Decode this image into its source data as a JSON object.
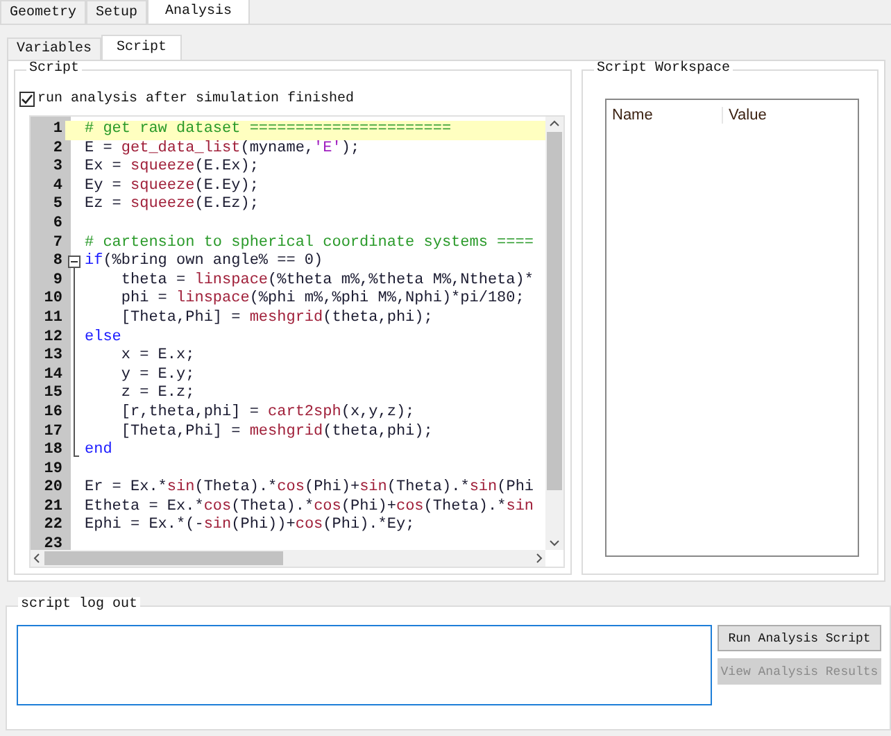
{
  "tabs": [
    {
      "label": "Geometry",
      "selected": false
    },
    {
      "label": "Setup",
      "selected": false
    },
    {
      "label": "Analysis",
      "selected": true
    }
  ],
  "subtabs": [
    {
      "label": "Variables",
      "selected": false
    },
    {
      "label": "Script",
      "selected": true
    }
  ],
  "script_group": {
    "title": "Script",
    "checkbox": {
      "label": "run analysis after simulation finished",
      "checked": true
    },
    "editor": {
      "lines": [
        {
          "n": "1",
          "current": true,
          "kind": "plain",
          "segments": [
            {
              "t": "# get raw dataset ======================",
              "kind": "comment"
            }
          ]
        },
        {
          "n": "2",
          "current": false,
          "kind": "plain",
          "segments": [
            {
              "t": "E = ",
              "kind": "plain"
            },
            {
              "t": "get_data_list",
              "kind": "func"
            },
            {
              "t": "(myname,",
              "kind": "plain"
            },
            {
              "t": "'E'",
              "kind": "string"
            },
            {
              "t": ");",
              "kind": "plain"
            }
          ]
        },
        {
          "n": "3",
          "current": false,
          "kind": "plain",
          "segments": [
            {
              "t": "Ex = ",
              "kind": "plain"
            },
            {
              "t": "squeeze",
              "kind": "func"
            },
            {
              "t": "(E.Ex);",
              "kind": "plain"
            }
          ]
        },
        {
          "n": "4",
          "current": false,
          "kind": "plain",
          "segments": [
            {
              "t": "Ey = ",
              "kind": "plain"
            },
            {
              "t": "squeeze",
              "kind": "func"
            },
            {
              "t": "(E.Ey);",
              "kind": "plain"
            }
          ]
        },
        {
          "n": "5",
          "current": false,
          "kind": "plain",
          "segments": [
            {
              "t": "Ez = ",
              "kind": "plain"
            },
            {
              "t": "squeeze",
              "kind": "func"
            },
            {
              "t": "(E.Ez);",
              "kind": "plain"
            }
          ]
        },
        {
          "n": "6",
          "current": false,
          "kind": "plain"
        },
        {
          "n": "7",
          "current": false,
          "kind": "plain",
          "segments": [
            {
              "t": "# cartension to spherical coordinate systems ====",
              "kind": "comment"
            }
          ]
        },
        {
          "n": "8",
          "current": false,
          "kind": "fold-start",
          "segments": [
            {
              "t": "if",
              "kind": "keyword"
            },
            {
              "t": "(%bring own angle% == 0)",
              "kind": "plain"
            }
          ]
        },
        {
          "n": "9",
          "current": false,
          "kind": "fold-inside",
          "segments": [
            {
              "t": "    theta = ",
              "kind": "plain"
            },
            {
              "t": "linspace",
              "kind": "func"
            },
            {
              "t": "(%theta m%,%theta M%,Ntheta)*",
              "kind": "plain"
            }
          ]
        },
        {
          "n": "10",
          "current": false,
          "kind": "fold-inside",
          "segments": [
            {
              "t": "    phi = ",
              "kind": "plain"
            },
            {
              "t": "linspace",
              "kind": "func"
            },
            {
              "t": "(%phi m%,%phi M%,Nphi)*pi/180;",
              "kind": "plain"
            }
          ]
        },
        {
          "n": "11",
          "current": false,
          "kind": "fold-inside",
          "segments": [
            {
              "t": "    [Theta,Phi] = ",
              "kind": "plain"
            },
            {
              "t": "meshgrid",
              "kind": "func"
            },
            {
              "t": "(theta,phi);",
              "kind": "plain"
            }
          ]
        },
        {
          "n": "12",
          "current": false,
          "kind": "fold-inside",
          "segments": [
            {
              "t": "else",
              "kind": "keyword"
            }
          ]
        },
        {
          "n": "13",
          "current": false,
          "kind": "fold-inside",
          "segments": [
            {
              "t": "    x = E.x;",
              "kind": "plain"
            }
          ]
        },
        {
          "n": "14",
          "current": false,
          "kind": "fold-inside",
          "segments": [
            {
              "t": "    y = E.y;",
              "kind": "plain"
            }
          ]
        },
        {
          "n": "15",
          "current": false,
          "kind": "fold-inside",
          "segments": [
            {
              "t": "    z = E.z;",
              "kind": "plain"
            }
          ]
        },
        {
          "n": "16",
          "current": false,
          "kind": "fold-inside",
          "segments": [
            {
              "t": "    [r,theta,phi] = ",
              "kind": "plain"
            },
            {
              "t": "cart2sph",
              "kind": "func"
            },
            {
              "t": "(x,y,z);",
              "kind": "plain"
            }
          ]
        },
        {
          "n": "17",
          "current": false,
          "kind": "fold-inside",
          "segments": [
            {
              "t": "    [Theta,Phi] = ",
              "kind": "plain"
            },
            {
              "t": "meshgrid",
              "kind": "func"
            },
            {
              "t": "(theta,phi);",
              "kind": "plain"
            }
          ]
        },
        {
          "n": "18",
          "current": false,
          "kind": "fold-end",
          "segments": [
            {
              "t": "end",
              "kind": "keyword"
            }
          ]
        },
        {
          "n": "19",
          "current": false,
          "kind": "plain"
        },
        {
          "n": "20",
          "current": false,
          "kind": "plain",
          "segments": [
            {
              "t": "Er = Ex.*",
              "kind": "plain"
            },
            {
              "t": "sin",
              "kind": "func"
            },
            {
              "t": "(Theta).*",
              "kind": "plain"
            },
            {
              "t": "cos",
              "kind": "func"
            },
            {
              "t": "(Phi)+",
              "kind": "plain"
            },
            {
              "t": "sin",
              "kind": "func"
            },
            {
              "t": "(Theta).*",
              "kind": "plain"
            },
            {
              "t": "sin",
              "kind": "func"
            },
            {
              "t": "(Phi",
              "kind": "plain"
            }
          ]
        },
        {
          "n": "21",
          "current": false,
          "kind": "plain",
          "segments": [
            {
              "t": "Etheta = Ex.*",
              "kind": "plain"
            },
            {
              "t": "cos",
              "kind": "func"
            },
            {
              "t": "(Theta).*",
              "kind": "plain"
            },
            {
              "t": "cos",
              "kind": "func"
            },
            {
              "t": "(Phi)+",
              "kind": "plain"
            },
            {
              "t": "cos",
              "kind": "func"
            },
            {
              "t": "(Theta).*",
              "kind": "plain"
            },
            {
              "t": "sin",
              "kind": "func"
            }
          ]
        },
        {
          "n": "22",
          "current": false,
          "kind": "plain",
          "segments": [
            {
              "t": "Ephi = Ex.*(-",
              "kind": "plain"
            },
            {
              "t": "sin",
              "kind": "func"
            },
            {
              "t": "(Phi))+",
              "kind": "plain"
            },
            {
              "t": "cos",
              "kind": "func"
            },
            {
              "t": "(Phi).*Ey;",
              "kind": "plain"
            }
          ]
        },
        {
          "n": "23",
          "current": false,
          "kind": "plain"
        }
      ]
    }
  },
  "workspace_group": {
    "title": "Script Workspace",
    "table": {
      "columns": [
        "Name",
        "Value"
      ]
    }
  },
  "log_group": {
    "title": "script log out",
    "buttons": [
      {
        "label": "Run Analysis Script",
        "disabled": false
      },
      {
        "label": "View Analysis Results",
        "disabled": true
      }
    ]
  }
}
